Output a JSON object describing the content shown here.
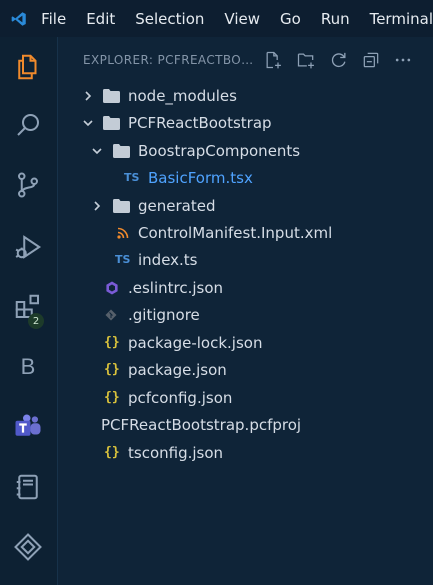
{
  "menu": [
    "File",
    "Edit",
    "Selection",
    "View",
    "Go",
    "Run",
    "Terminal"
  ],
  "explorer": {
    "title": "EXPLORER: PCFREACTBOOTSTRAP"
  },
  "activity": {
    "badge": "2",
    "b_label": "B"
  },
  "tree": [
    {
      "label": "node_modules",
      "type": "folder",
      "state": "collapsed"
    },
    {
      "label": "PCFReactBootstrap",
      "type": "folder",
      "state": "expanded"
    },
    {
      "label": "BoostrapComponents",
      "type": "folder",
      "state": "expanded"
    },
    {
      "label": "BasicForm.tsx",
      "type": "ts",
      "icon_text": "TS",
      "selected": true
    },
    {
      "label": "generated",
      "type": "folder",
      "state": "collapsed"
    },
    {
      "label": "ControlManifest.Input.xml",
      "type": "rss"
    },
    {
      "label": "index.ts",
      "type": "ts",
      "icon_text": "TS"
    },
    {
      "label": ".eslintrc.json",
      "type": "eslint"
    },
    {
      "label": ".gitignore",
      "type": "git"
    },
    {
      "label": "package-lock.json",
      "type": "json",
      "icon_text": "{}"
    },
    {
      "label": "package.json",
      "type": "json",
      "icon_text": "{}"
    },
    {
      "label": "pcfconfig.json",
      "type": "json",
      "icon_text": "{}"
    },
    {
      "label": "PCFReactBootstrap.pcfproj",
      "type": "plain"
    },
    {
      "label": "tsconfig.json",
      "type": "json",
      "icon_text": "{}"
    }
  ],
  "colors": {
    "background": "#0f2438",
    "accent_orange": "#f08a2c",
    "selected_text": "#4fa3ff",
    "json_icon": "#d9c23c",
    "ts_icon": "#4a8fd6"
  }
}
